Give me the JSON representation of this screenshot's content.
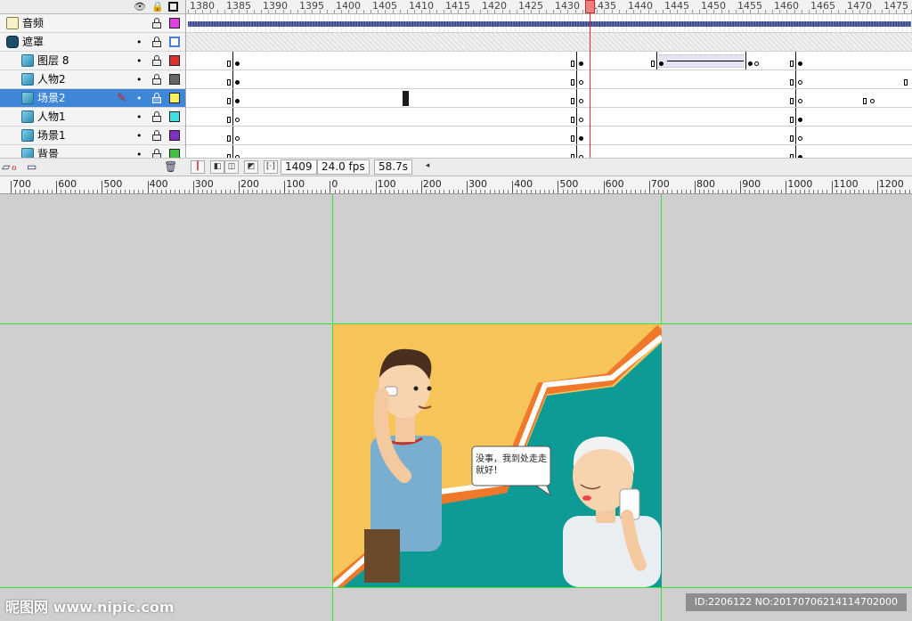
{
  "layers": [
    {
      "name": "音频",
      "type": "audio",
      "visible_dot": "",
      "outline_color": "#e040e0"
    },
    {
      "name": "遮罩",
      "type": "mask",
      "visible_dot": "•",
      "outline_color": "hollow"
    },
    {
      "name": "图层 8",
      "type": "normal",
      "visible_dot": "•",
      "outline_color": "#e03030"
    },
    {
      "name": "人物2",
      "type": "normal",
      "visible_dot": "•",
      "outline_color": "#666666"
    },
    {
      "name": "场景2",
      "type": "normal",
      "visible_dot": "•",
      "outline_color": "#f8f060",
      "selected": true,
      "editing_icon": "pencil-crossed-icon"
    },
    {
      "name": "人物1",
      "type": "normal",
      "visible_dot": "•",
      "outline_color": "#40e0e0"
    },
    {
      "name": "场景1",
      "type": "normal",
      "visible_dot": "•",
      "outline_color": "#8030c0"
    },
    {
      "name": "背景",
      "type": "normal",
      "visible_dot": "•",
      "outline_color": "#40c040"
    }
  ],
  "timeline_header": {
    "frame_numbers": [
      "1380",
      "1385",
      "1390",
      "1395",
      "1400",
      "1405",
      "1410",
      "1415",
      "1420",
      "1425",
      "1430",
      "1435",
      "1440",
      "1445",
      "1450",
      "1455",
      "1460",
      "1465",
      "1470",
      "1475"
    ]
  },
  "status_bar": {
    "current_frame": "1409",
    "frame_rate": "24.0 fps",
    "elapsed_time": "58.7s"
  },
  "stage_ruler": {
    "labels": [
      "700",
      "600",
      "500",
      "400",
      "300",
      "200",
      "100",
      "0",
      "100",
      "200",
      "300",
      "400",
      "500",
      "600",
      "700",
      "800",
      "900",
      "1000",
      "1100",
      "1200"
    ]
  },
  "artwork": {
    "speech_bubble": "没事，我到处走走就好！",
    "colors": {
      "background": "#f7c45a",
      "teal": "#0e9b95",
      "stripe_orange": "#f0782a",
      "stripe_white": "#ffffff"
    }
  },
  "watermarks": {
    "left": "昵图网 www.nipic.com",
    "right": "ID:2206122 NO:20170706214114702000"
  }
}
